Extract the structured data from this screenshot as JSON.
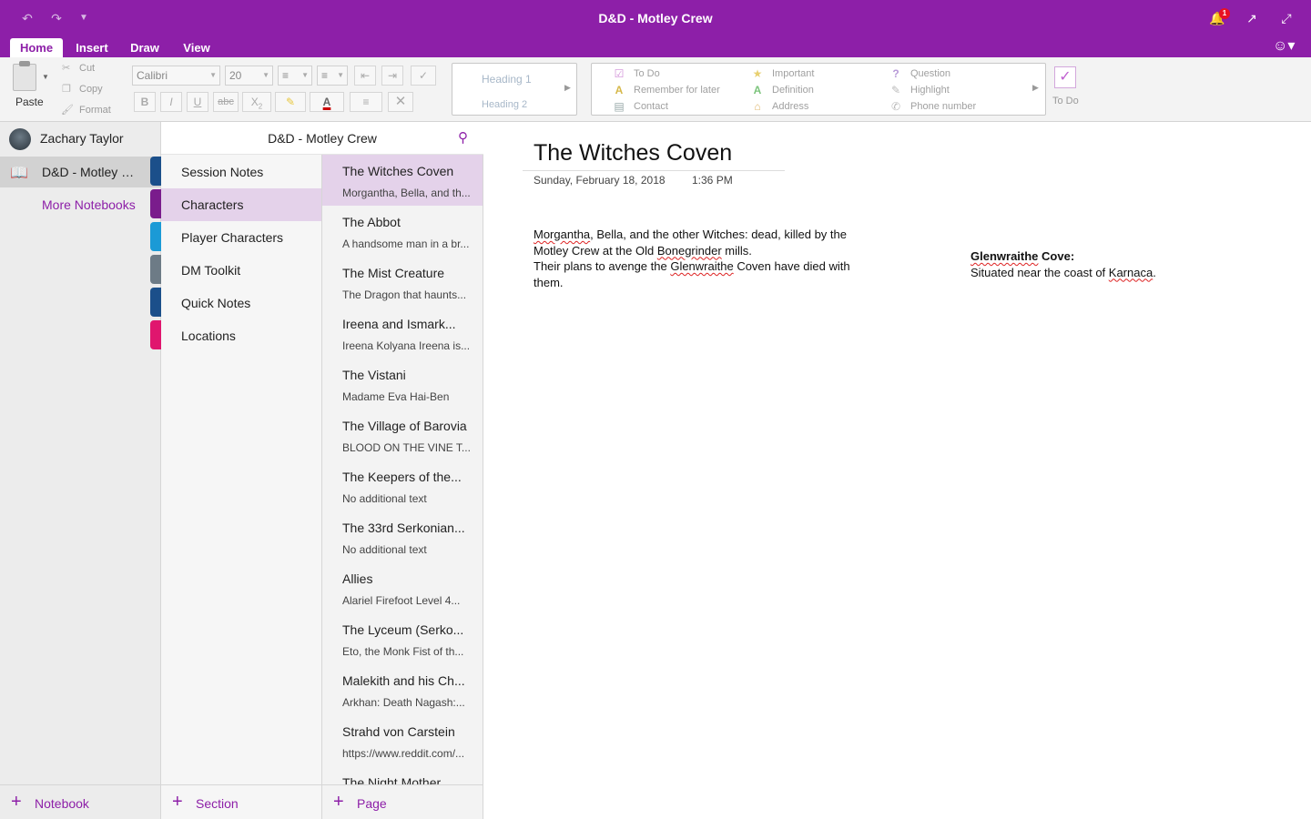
{
  "app": {
    "title": "D&D - Motley Crew",
    "notification_count": "1"
  },
  "titlebar_icons": {
    "undo": "undo-icon",
    "redo": "redo-icon",
    "customize": "customize-icon",
    "bell": "bell-icon",
    "share": "share-icon",
    "fullscreen": "fullscreen-icon"
  },
  "tabs": [
    {
      "label": "Home"
    },
    {
      "label": "Insert"
    },
    {
      "label": "Draw"
    },
    {
      "label": "View"
    }
  ],
  "ribbon": {
    "paste": "Paste",
    "cut": "Cut",
    "copy": "Copy",
    "format": "Format",
    "font": "Calibri",
    "size": "20",
    "bold": "B",
    "italic": "I",
    "underline": "U",
    "strike": "abc",
    "subscript": "X",
    "styles": {
      "heading1": "Heading 1",
      "heading2": "Heading 2"
    },
    "tags": {
      "todo": "To Do",
      "remember": "Remember for later",
      "contact": "Contact",
      "important": "Important",
      "definition": "Definition",
      "address": "Address",
      "question": "Question",
      "highlight": "Highlight",
      "phone": "Phone number"
    },
    "todo_button": "To Do"
  },
  "user": {
    "name": "Zachary Taylor"
  },
  "notebooks": {
    "current": "D&D - Motley Crew",
    "more": "More Notebooks",
    "add": "Notebook"
  },
  "sections": {
    "header": "D&D - Motley Crew",
    "items": [
      {
        "label": "Session Notes",
        "color": "#1b4f8a"
      },
      {
        "label": "Characters",
        "color": "#7a1c8c"
      },
      {
        "label": "Player Characters",
        "color": "#1b9ad6"
      },
      {
        "label": "DM Toolkit",
        "color": "#6d7b86"
      },
      {
        "label": "Quick Notes",
        "color": "#1b4f8a"
      },
      {
        "label": "Locations",
        "color": "#e0166e"
      }
    ],
    "add": "Section"
  },
  "pages": {
    "items": [
      {
        "title": "The Witches Coven",
        "sub": "Morgantha, Bella, and th..."
      },
      {
        "title": "The Abbot",
        "sub": "A handsome man in a br..."
      },
      {
        "title": "The Mist Creature",
        "sub": "The Dragon that haunts..."
      },
      {
        "title": "Ireena and Ismark...",
        "sub": "Ireena Kolyana  Ireena is..."
      },
      {
        "title": "The Vistani",
        "sub": "Madame Eva  Hai-Ben"
      },
      {
        "title": "The Village of Barovia",
        "sub": "BLOOD ON THE VINE T..."
      },
      {
        "title": "The Keepers of the...",
        "sub": "No additional text"
      },
      {
        "title": "The 33rd Serkonian...",
        "sub": "No additional text"
      },
      {
        "title": "Allies",
        "sub": "Alariel Firefoot  Level 4..."
      },
      {
        "title": "The Lyceum (Serko...",
        "sub": "Eto, the Monk  Fist of th..."
      },
      {
        "title": "Malekith and his Ch...",
        "sub": "Arkhan: Death  Nagash:..."
      },
      {
        "title": "Strahd von Carstein",
        "sub": "https://www.reddit.com/..."
      },
      {
        "title": "The Night Mother",
        "sub": ""
      }
    ],
    "add": "Page"
  },
  "page": {
    "title": "The Witches Coven",
    "date": "Sunday, February 18, 2018",
    "time": "1:36 PM",
    "note1": {
      "w1": "Morgantha",
      "t1": ", Bella, and the other Witches: dead, killed by the Motley Crew at the Old ",
      "w2": "Bonegrinder",
      "t2": " mills.",
      "t3": "Their plans to avenge the ",
      "w3": "Glenwraithe",
      "t4": " Coven have died with them."
    },
    "note2": {
      "w1": "Glenwraithe",
      "t1": " Cove:",
      "t2": "Situated near the coast of ",
      "w2": "Karnaca",
      "t3": "."
    }
  }
}
